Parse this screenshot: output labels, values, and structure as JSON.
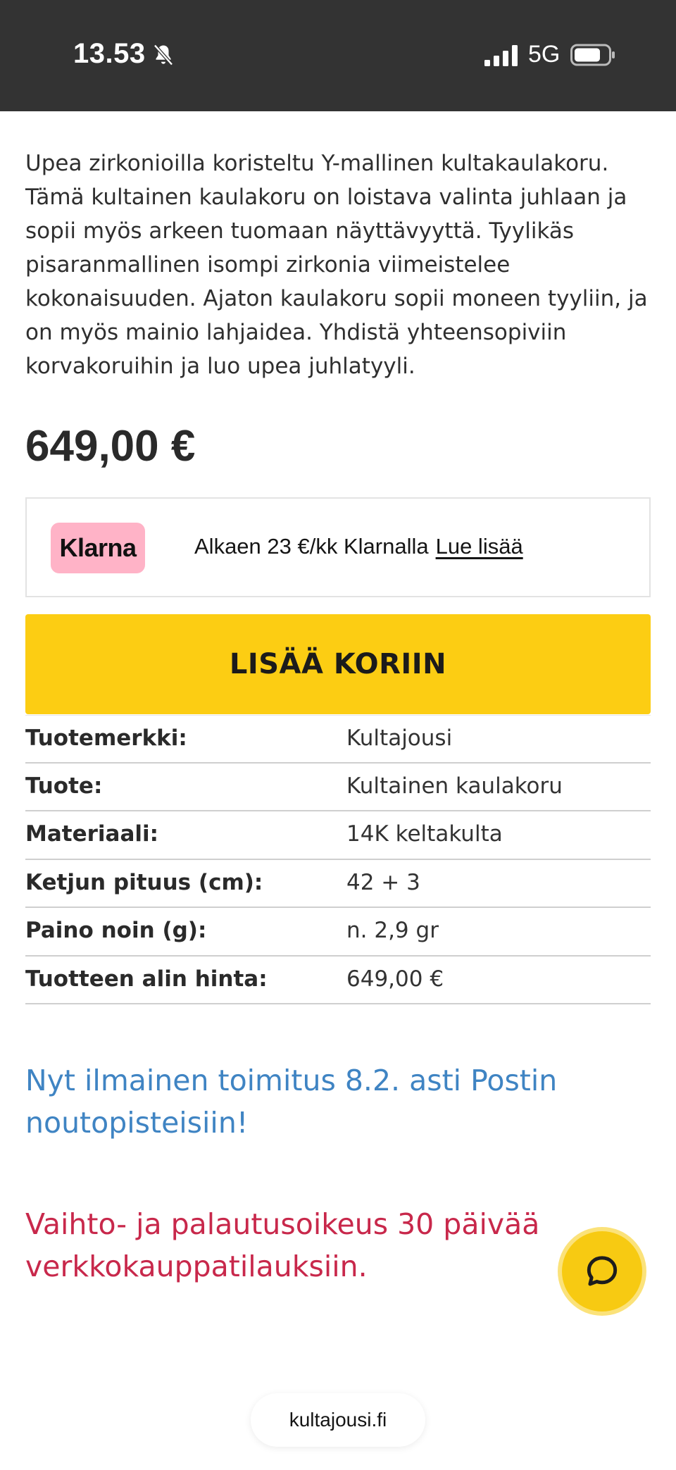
{
  "status_bar": {
    "time": "13.53",
    "network": "5G",
    "icons": [
      "bell-slash-icon",
      "signal-icon",
      "battery-icon"
    ]
  },
  "product": {
    "description": "Upea zirkonioilla koristeltu Y-mallinen kultakaulakoru. Tämä kultainen kaulakoru on loistava valinta juhlaan ja sopii myös arkeen tuomaan näyttävyyttä. Tyylikäs pisaranmallinen isompi zirkonia viimeistelee kokonaisuuden. Ajaton kaulakoru sopii moneen tyyliin, ja on myös mainio lahjaidea. Yhdistä yhteensopiviin korvakoruihin ja luo upea juhlatyyli.",
    "price": "649,00 €"
  },
  "klarna": {
    "badge": "Klarna",
    "text": "Alkaen 23 €/kk Klarnalla",
    "link": "Lue lisää",
    "badge_color": "#ffb3c7"
  },
  "cart": {
    "add_label": "LISÄÄ KORIIN",
    "button_color": "#fccd13"
  },
  "specs": [
    {
      "label": "Tuotemerkki:",
      "value": "Kultajousi"
    },
    {
      "label": "Tuote:",
      "value": "Kultainen kaulakoru"
    },
    {
      "label": "Materiaali:",
      "value": "14K keltakulta"
    },
    {
      "label": "Ketjun pituus (cm):",
      "value": "42 + 3"
    },
    {
      "label": "Paino noin (g):",
      "value": "n. 2,9 gr"
    },
    {
      "label": "Tuotteen alin hinta:",
      "value": "649,00 €"
    }
  ],
  "notices": {
    "shipping": "Nyt ilmainen toimitus 8.2. asti Postin noutopisteisiin!",
    "returns": "Vaihto- ja palautusoikeus 30 päivää verkkokauppatilauksiin.",
    "shipping_color": "#3f84c3",
    "returns_color": "#c8284b"
  },
  "chat": {
    "icon": "chat-bubble-icon"
  },
  "browser": {
    "url": "kultajousi.fi"
  }
}
